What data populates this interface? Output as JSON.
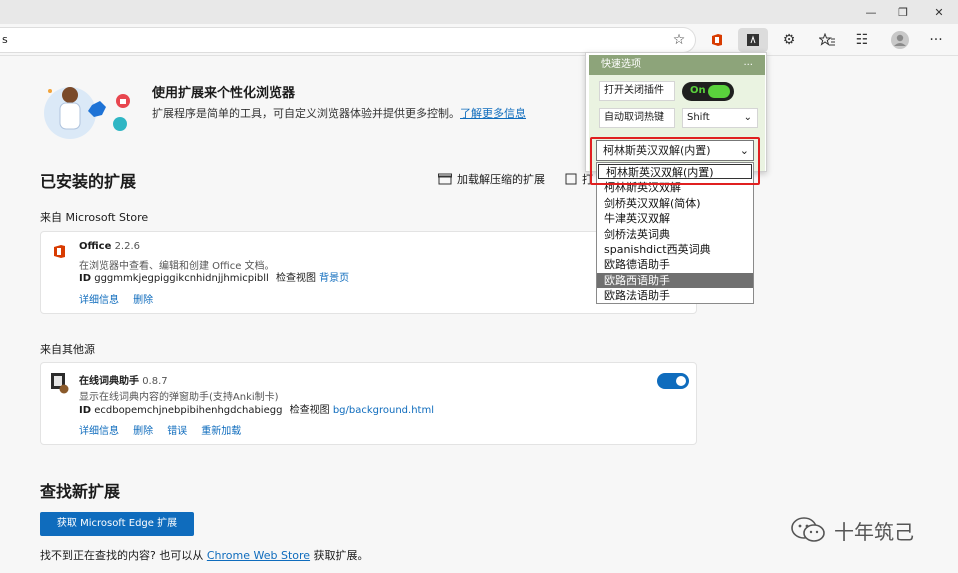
{
  "window": {
    "minimize_icon": "—",
    "restore_icon": "❐",
    "close_icon": "✕"
  },
  "addressbar": {
    "url_fragment": "s"
  },
  "toolbar": {
    "favorite_icon": "☆",
    "extensions_icon": "⚙",
    "collections_icon": "☷",
    "more_icon": "···"
  },
  "hero": {
    "title": "使用扩展来个性化浏览器",
    "desc": "扩展程序是简单的工具，可自定义浏览器体验并提供更多控制。",
    "learn_more": "了解更多信息"
  },
  "installed": {
    "title": "已安装的扩展",
    "load_unpacked": "加载解压缩的扩展",
    "pack": "打",
    "from_store": "来自 Microsoft Store",
    "from_other": "来自其他源"
  },
  "office": {
    "name": "Office",
    "version": "2.2.6",
    "desc": "在浏览器中查看、编辑和创建 Office 文档。",
    "id_label": "ID",
    "id": "gggmmkjegpiggikcnhidnjjhmicpibll",
    "inspect": "检查视图",
    "inspect_link": "背景页",
    "details": "详细信息",
    "remove": "删除"
  },
  "dict_ext": {
    "name": "在线词典助手",
    "version": "0.8.7",
    "desc": "显示在线词典内容的弹窗助手(支持Anki制卡)",
    "id_label": "ID",
    "id": "ecdbopemchjnebpibihenhgdchabiegg",
    "inspect": "检查视图",
    "inspect_link": "bg/background.html",
    "details": "详细信息",
    "remove": "删除",
    "errors": "错误",
    "reload": "重新加载"
  },
  "find": {
    "title": "查找新扩展",
    "button": "获取 Microsoft Edge 扩展",
    "text_before": "找不到正在查找的内容? 也可以从",
    "store_link": "Chrome Web Store",
    "text_after": "获取扩展。"
  },
  "popup": {
    "title": "快速选项",
    "menu": "...",
    "toggle_label": "打开关闭插件",
    "toggle_state": "On",
    "hotkey_label": "自动取词热键",
    "hotkey_value": "Shift",
    "dict_selected": "柯林斯英汉双解(内置)",
    "dict_options": [
      "柯林斯英汉双解(内置)",
      "柯林斯英汉双解",
      "剑桥英汉双解(简体)",
      "牛津英汉双解",
      "剑桥法英词典",
      "spanishdict西英词典",
      "欧路德语助手",
      "欧路西语助手",
      "欧路法语助手"
    ],
    "highlighted_index": 7
  },
  "watermark": {
    "text": "十年筑己"
  },
  "colors": {
    "accent": "#0f6cbd",
    "popup_header": "#8da47a",
    "popup_body": "#eaf3e1",
    "toggle_green": "#5ad13c",
    "highlight": "#c00000"
  }
}
